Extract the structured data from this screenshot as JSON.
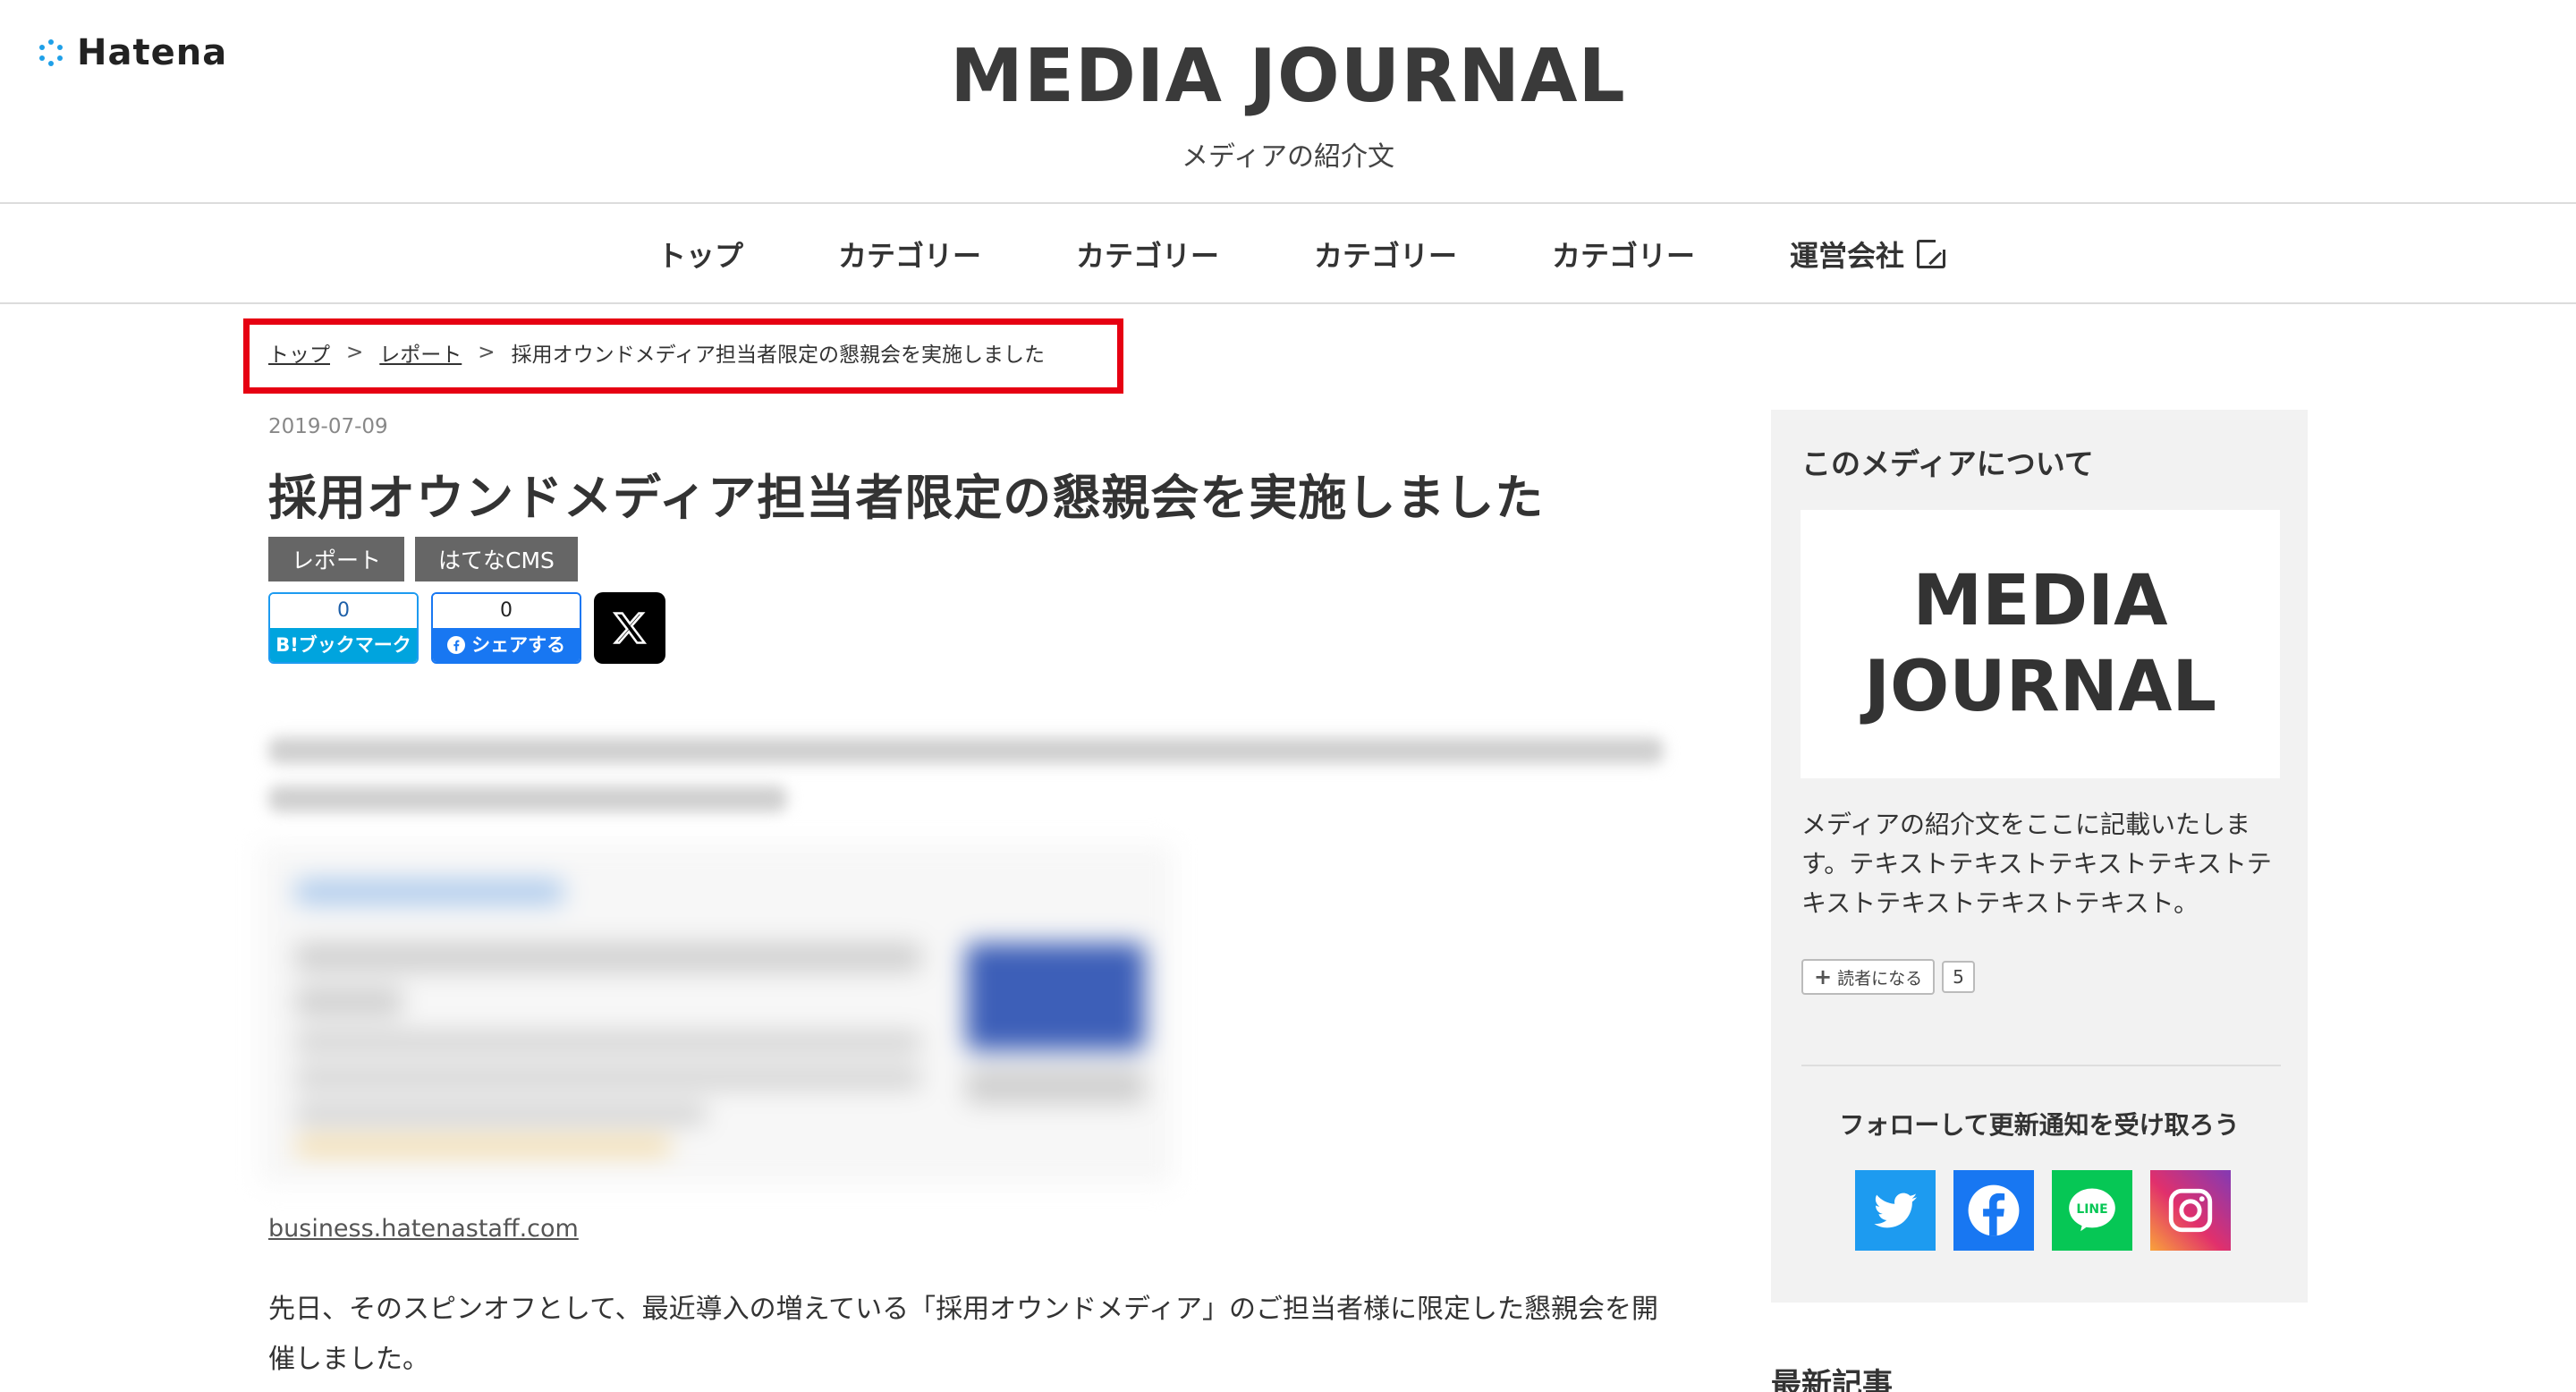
{
  "header": {
    "brand": "Hatena",
    "site_title": "MEDIA JOURNAL",
    "site_description": "メディアの紹介文"
  },
  "nav": {
    "items": [
      "トップ",
      "カテゴリー",
      "カテゴリー",
      "カテゴリー",
      "カテゴリー",
      "運営会社"
    ]
  },
  "breadcrumb": {
    "items": [
      "トップ",
      "レポート",
      "採用オウンドメディア担当者限定の懇親会を実施しました"
    ],
    "separator": ">"
  },
  "article": {
    "date": "2019-07-09",
    "title": "採用オウンドメディア担当者限定の懇親会を実施しました",
    "tags": [
      "レポート",
      "はてなCMS"
    ],
    "share": {
      "hatena_count": "0",
      "hatena_label": "B!ブックマーク",
      "facebook_count": "0",
      "facebook_label": "シェアする",
      "x_icon": "x-logo"
    },
    "link_text": "business.hatenastaff.com",
    "body": "先日、そのスピンオフとして、最近導入の増えている「採用オウンドメディア」のご担当者様に限定した懇親会を開催しました。"
  },
  "sidebar": {
    "heading": "このメディアについて",
    "logo_text_line1": "MEDIA",
    "logo_text_line2": "JOURNAL",
    "description": "メディアの紹介文をここに記載いたします。テキストテキストテキストテキストテキストテキストテキストテキスト。",
    "reader_button": "読者になる",
    "reader_count": "5",
    "follow_text": "フォローして更新通知を受け取ろう",
    "sns": [
      "twitter-icon",
      "facebook-icon",
      "line-icon",
      "instagram-icon"
    ],
    "latest_heading": "最新記事"
  },
  "colors": {
    "highlight_border": "#e60012",
    "hatena_blue": "#00a4de",
    "facebook_blue": "#1877f2",
    "twitter_blue": "#1d9bf0",
    "line_green": "#06c755",
    "tag_gray": "#666666"
  }
}
